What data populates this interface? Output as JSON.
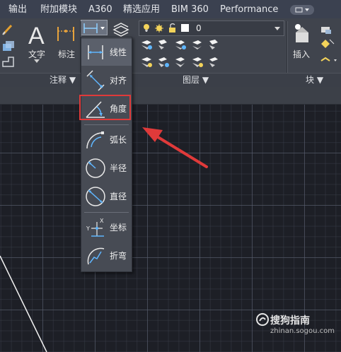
{
  "tabs": [
    "输出",
    "附加模块",
    "A360",
    "精选应用",
    "BIM 360",
    "Performance"
  ],
  "ribbon": {
    "text_label": "文字",
    "dimension_label": "标注",
    "insert_label": "插入",
    "layer_value": "0",
    "panels": {
      "annotation": "注释 ▼",
      "layers": "图层 ▼",
      "block": "块 ▼"
    }
  },
  "dropdown": {
    "items": [
      {
        "label": "线性",
        "icon": "linear-dimension-icon"
      },
      {
        "label": "对齐",
        "icon": "aligned-dimension-icon"
      },
      {
        "label": "角度",
        "icon": "angular-dimension-icon"
      },
      {
        "label": "弧长",
        "icon": "arc-length-icon"
      },
      {
        "label": "半径",
        "icon": "radius-dimension-icon"
      },
      {
        "label": "直径",
        "icon": "diameter-dimension-icon"
      },
      {
        "label": "坐标",
        "icon": "ordinate-dimension-icon"
      },
      {
        "label": "折弯",
        "icon": "jogged-dimension-icon"
      }
    ]
  },
  "colors": {
    "highlight": "#e03a3a",
    "accent_icon": "#5fb6ff"
  },
  "watermark": {
    "brand": "搜狗指南",
    "site": "zhinan.sogou.com"
  }
}
